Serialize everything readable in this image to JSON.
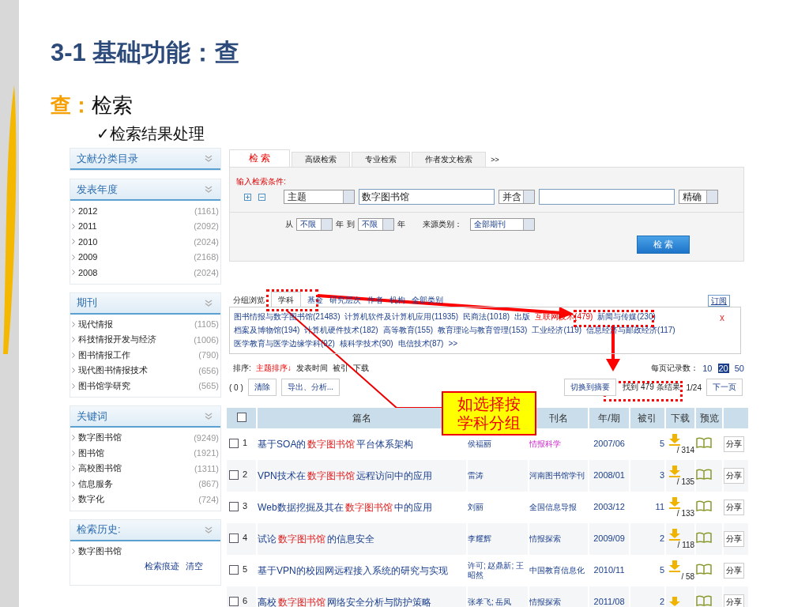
{
  "slide": {
    "title": "3-1 基础功能：查",
    "heading_label": "查：",
    "heading_text": "检索",
    "bullet_mark": "✓",
    "bullet_text": "检索结果处理"
  },
  "sidebar": [
    {
      "title": "文献分类目录"
    },
    {
      "title": "发表年度",
      "items": [
        {
          "label": "2012",
          "count": "(1161)"
        },
        {
          "label": "2011",
          "count": "(2092)"
        },
        {
          "label": "2010",
          "count": "(2024)"
        },
        {
          "label": "2009",
          "count": "(2168)"
        },
        {
          "label": "2008",
          "count": "(2024)"
        }
      ]
    },
    {
      "title": "期刊",
      "items": [
        {
          "label": "现代情报",
          "count": "(1105)"
        },
        {
          "label": "科技情报开发与经济",
          "count": "(1006)"
        },
        {
          "label": "图书情报工作",
          "count": "(790)"
        },
        {
          "label": "现代图书情报技术",
          "count": "(656)"
        },
        {
          "label": "图书馆学研究",
          "count": "(565)"
        }
      ]
    },
    {
      "title": "关键词",
      "items": [
        {
          "label": "数字图书馆",
          "count": "(9249)"
        },
        {
          "label": "图书馆",
          "count": "(1921)"
        },
        {
          "label": "高校图书馆",
          "count": "(1311)"
        },
        {
          "label": "信息服务",
          "count": "(867)"
        },
        {
          "label": "数字化",
          "count": "(724)"
        }
      ]
    },
    {
      "title": "检索历史:",
      "items": [
        {
          "label": "数字图书馆"
        }
      ],
      "links": [
        "检索痕迹",
        "清空"
      ]
    }
  ],
  "search": {
    "tabs": [
      {
        "label": "检 索",
        "selected": true
      },
      {
        "label": "高级检索",
        "selected": false
      },
      {
        "label": "专业检索",
        "selected": false
      },
      {
        "label": "作者发文检索",
        "selected": false
      }
    ],
    "more": ">>",
    "prompt": "输入检索条件:",
    "field": "主题",
    "value": "数字图书馆",
    "operator": "并含",
    "match": "精确",
    "from_label": "从",
    "from_year": "不限",
    "year_label_1": "年",
    "to_label": "到",
    "to_year": "不限",
    "year_label_2": "年",
    "source_label": "来源类别：",
    "source": "全部期刊",
    "button": "检 索"
  },
  "grouping": {
    "label": "分组浏览",
    "tabs": [
      {
        "label": "学科",
        "selected": true
      },
      {
        "label": "基金",
        "selected": false
      },
      {
        "label": "研究层次",
        "selected": false
      },
      {
        "label": "作者",
        "selected": false
      },
      {
        "label": "机构",
        "selected": false
      },
      {
        "label": "全部类别",
        "selected": false
      }
    ],
    "subscribe": "订阅",
    "close": "x",
    "more": ">>",
    "subjects": [
      {
        "label": "图书情报与数字图书馆(21483)",
        "selected": false
      },
      {
        "label": "计算机软件及计算机应用(11935)",
        "selected": false
      },
      {
        "label": "民商法(1018)",
        "selected": false
      },
      {
        "label": "出版",
        "selected": false
      },
      {
        "label": "互联网技术(479)",
        "selected": true
      },
      {
        "label": "新闻与传媒(230)",
        "selected": false
      },
      {
        "label": "档案及博物馆(194)",
        "selected": false
      },
      {
        "label": "计算机硬件技术(182)",
        "selected": false
      },
      {
        "label": "高等教育(155)",
        "selected": false
      },
      {
        "label": "教育理论与教育管理(153)",
        "selected": false
      },
      {
        "label": "工业经济(119)",
        "selected": false
      },
      {
        "label": "信息经济与邮政经济(117)",
        "selected": false
      },
      {
        "label": "医学教育与医学边缘学科(92)",
        "selected": false
      },
      {
        "label": "核科学技术(90)",
        "selected": false
      },
      {
        "label": "电信技术(87)",
        "selected": false
      }
    ]
  },
  "sort": {
    "label": "排序:",
    "options": [
      {
        "label": "主题排序↓",
        "selected": true
      },
      {
        "label": "发表时间",
        "selected": false
      },
      {
        "label": "被引",
        "selected": false
      },
      {
        "label": "下载",
        "selected": false
      }
    ],
    "per_page_label": "每页记录数：",
    "per_page": [
      {
        "label": "10",
        "selected": false
      },
      {
        "label": "20",
        "selected": true
      },
      {
        "label": "50",
        "selected": false
      }
    ]
  },
  "toolbar": {
    "count": "( 0 )",
    "clear": "清除",
    "export": "导出、分析...",
    "switch": "切换到摘要",
    "found": "找到 479 条结果",
    "page": "1/24",
    "next": "下一页"
  },
  "table": {
    "select_all_checked": false,
    "columns": [
      "篇名",
      "刊名",
      "年/期",
      "被引",
      "下载",
      "预览"
    ],
    "rows": [
      {
        "checked": false,
        "num": "1",
        "title_before": "基于SOA的",
        "keyword": "数字图书馆",
        "title_after": "平台体系架构",
        "author": "侯福丽",
        "journal": "情报科学",
        "highlighted": true,
        "date": "2007/06",
        "cited": "5",
        "downloads": "/ 314",
        "share": "分享"
      },
      {
        "checked": false,
        "num": "2",
        "title_before": "VPN技术在",
        "keyword": "数字图书馆",
        "title_after": "远程访问中的应用",
        "author": "雷涛",
        "journal": "河南图书馆学刊",
        "highlighted": false,
        "date": "2008/01",
        "cited": "3",
        "downloads": "/ 135",
        "share": "分享"
      },
      {
        "checked": false,
        "num": "3",
        "title_before": "Web数据挖掘及其在",
        "keyword": "数字图书馆",
        "title_after": "中的应用",
        "author": "刘丽",
        "journal": "全国信息导报",
        "highlighted": false,
        "date": "2003/12",
        "cited": "11",
        "downloads": "/ 133",
        "share": "分享"
      },
      {
        "checked": false,
        "num": "4",
        "title_before": "试论",
        "keyword": "数字图书馆",
        "title_after": "的信息安全",
        "author": "李耀辉",
        "journal": "情报探索",
        "highlighted": false,
        "date": "2009/09",
        "cited": "2",
        "downloads": "/ 118",
        "share": "分享"
      },
      {
        "checked": false,
        "num": "5",
        "title_before": "基于VPN的校园网远程接入系统的研究与实现",
        "keyword": "",
        "title_after": "",
        "author": "许可; 赵鼎新; 王昭然",
        "journal": "中国教育信息化",
        "highlighted": false,
        "date": "2010/11",
        "cited": "5",
        "downloads": "/ 58",
        "share": "分享"
      },
      {
        "checked": false,
        "num": "6",
        "title_before": "高校",
        "keyword": "数字图书馆",
        "title_after": "网络安全分析与防护策略",
        "author": "张孝飞; 岳凤",
        "journal": "情报探索",
        "highlighted": false,
        "date": "2011/08",
        "cited": "2",
        "downloads": "",
        "share": "分享"
      }
    ]
  },
  "callout": "如选择按学科分组"
}
